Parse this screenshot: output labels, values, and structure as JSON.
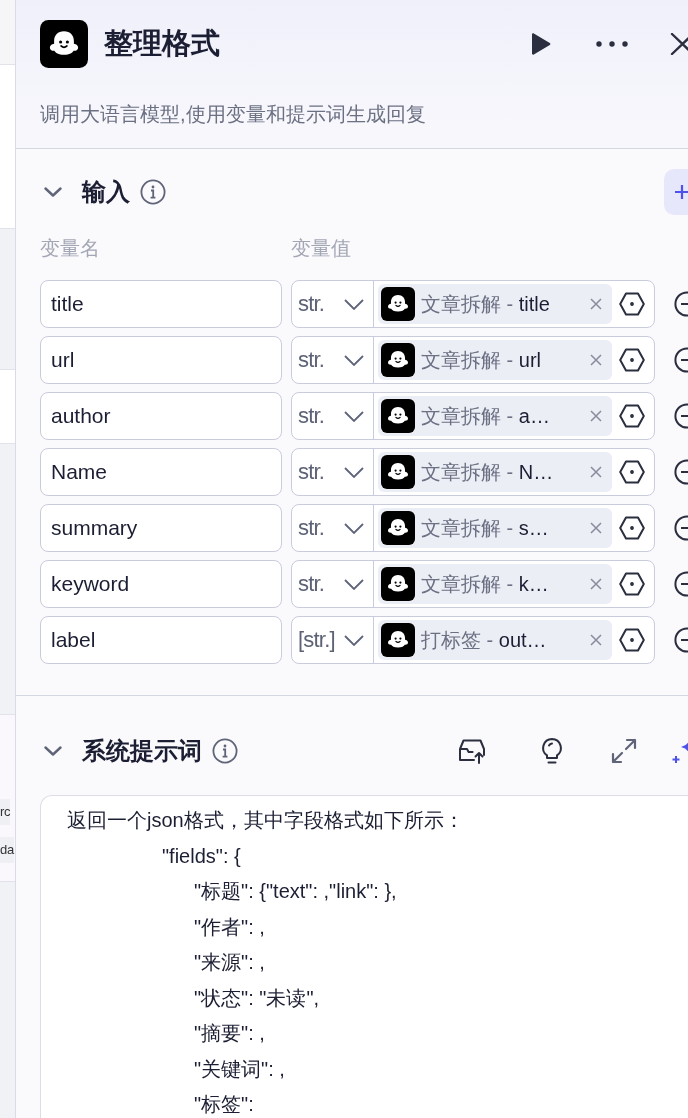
{
  "canvas": {
    "fragments": [
      {
        "text": "rc"
      },
      {
        "text": "da"
      }
    ]
  },
  "node": {
    "title": "整理格式",
    "description": "调用大语言模型,使用变量和提示词生成回复"
  },
  "input_section": {
    "title": "输入",
    "expanded": true,
    "column_headers": [
      "变量名",
      "变量值"
    ],
    "variables": [
      {
        "name": "title",
        "type": "str.",
        "reference": "文章拆解 - **title**"
      },
      {
        "name": "url",
        "type": "str.",
        "reference": "文章拆解 - **url**"
      },
      {
        "name": "author",
        "type": "str.",
        "reference": "文章拆解 - **a…**"
      },
      {
        "name": "Name",
        "type": "str.",
        "reference": "文章拆解 - **N…**"
      },
      {
        "name": "summary",
        "type": "str.",
        "reference": "文章拆解 - **s…**"
      },
      {
        "name": "keyword",
        "type": "str.",
        "reference": "文章拆解 - **k…**"
      },
      {
        "name": "label",
        "type": "[str.]",
        "reference": "打标签 - **out…**"
      }
    ]
  },
  "system_prompt": {
    "title": "系统提示词",
    "expanded": true,
    "lines": [
      {
        "text": "返回一个json格式，其中字段格式如下所示：",
        "children": [
          {
            "text": "\"fields\": {",
            "children": [
              {
                "text": "\"标题\": {\"text\": ,\"link\": },"
              },
              {
                "text": "\"作者\": ,"
              },
              {
                "text": "\"来源\": ,"
              },
              {
                "text": "\"状态\": \"未读\","
              },
              {
                "text": "\"摘要\": ,"
              },
              {
                "text": "\"关键词\": ,"
              },
              {
                "text": "\"标签\":"
              }
            ]
          }
        ]
      }
    ]
  }
}
